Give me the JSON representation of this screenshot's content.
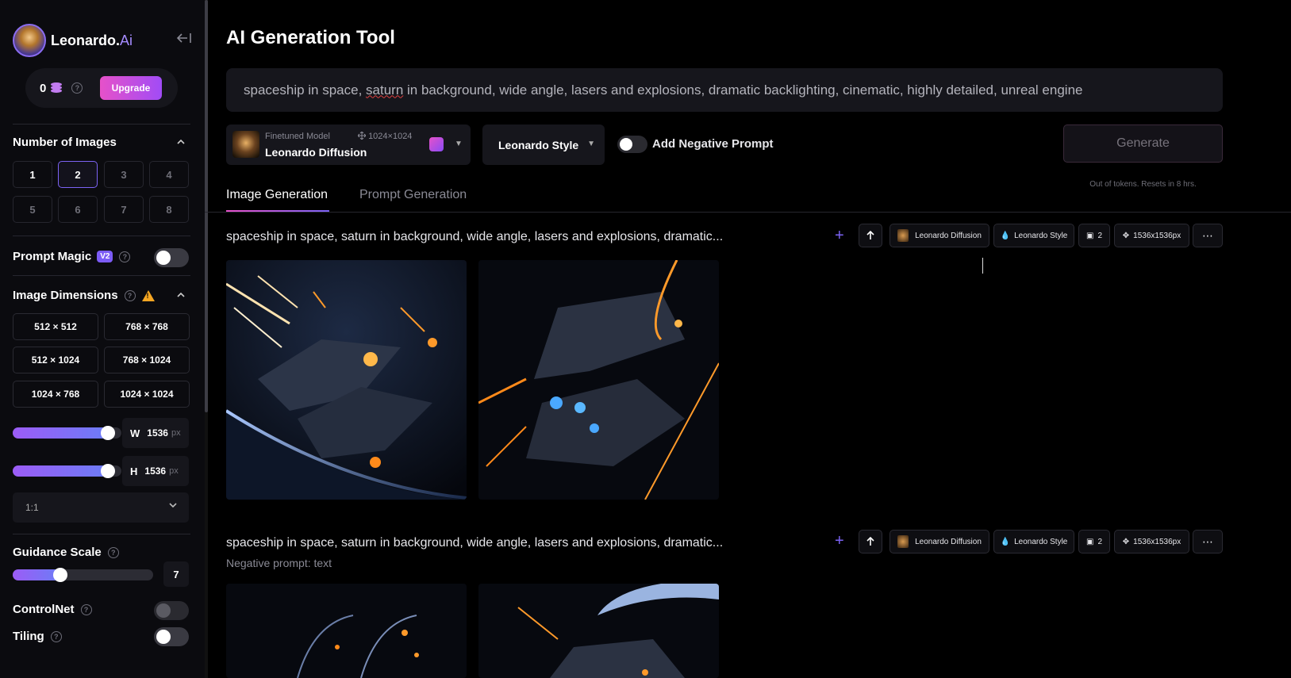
{
  "sidebar": {
    "brand": {
      "name": "Leonardo.",
      "suffix": "Ai"
    },
    "tokens": {
      "count": "0",
      "upgrade_label": "Upgrade"
    },
    "num_images": {
      "title": "Number of Images",
      "options": [
        "1",
        "2",
        "3",
        "4",
        "5",
        "6",
        "7",
        "8"
      ],
      "selected": "2"
    },
    "prompt_magic": {
      "title": "Prompt Magic",
      "badge": "V2"
    },
    "image_dimensions": {
      "title": "Image Dimensions",
      "options": [
        "512 × 512",
        "768 × 768",
        "512 × 1024",
        "768 × 1024",
        "1024 × 768",
        "1024 × 1024"
      ]
    },
    "width": {
      "label": "W",
      "value": "1536",
      "unit": "px",
      "fraction": 0.93
    },
    "height": {
      "label": "H",
      "value": "1536",
      "unit": "px",
      "fraction": 0.93
    },
    "aspect_ratio": "1:1",
    "guidance": {
      "title": "Guidance Scale",
      "value": "7",
      "fraction": 0.32
    },
    "controlnet": {
      "title": "ControlNet"
    },
    "tiling": {
      "title": "Tiling"
    }
  },
  "main": {
    "title": "AI Generation Tool",
    "prompt": {
      "before": "spaceship in space, ",
      "misspelled": "saturn",
      "after": " in background, wide angle, lasers and explosions, dramatic backlighting, cinematic, highly detailed, unreal engine"
    },
    "model": {
      "subtitle": "Finetuned Model",
      "dimensions": "1024×1024",
      "name": "Leonardo Diffusion"
    },
    "style": "Leonardo Style",
    "negative_prompt_label": "Add Negative Prompt",
    "generate_label": "Generate",
    "token_note": "Out of tokens. Resets in 8 hrs.",
    "tabs": [
      "Image Generation",
      "Prompt Generation"
    ],
    "generations": [
      {
        "prompt": "spaceship in space, saturn in background, wide angle, lasers and explosions, dramatic...",
        "chips": {
          "model": "Leonardo Diffusion",
          "style": "Leonardo Style",
          "count": "2",
          "size": "1536x1536px"
        }
      },
      {
        "prompt": "spaceship in space, saturn in background, wide angle, lasers and explosions, dramatic...",
        "negative": "Negative prompt: text",
        "chips": {
          "model": "Leonardo Diffusion",
          "style": "Leonardo Style",
          "count": "2",
          "size": "1536x1536px"
        }
      }
    ]
  },
  "colors": {
    "accent": "#7c63f5",
    "pink": "#e651c9",
    "bg": "#000000",
    "panel": "#16161c"
  }
}
